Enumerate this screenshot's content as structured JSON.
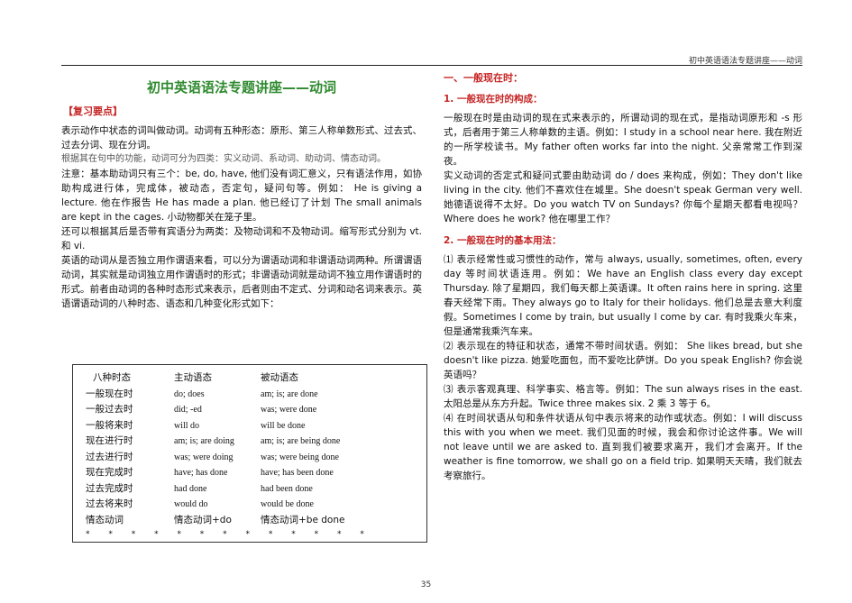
{
  "running_header": "初中英语语法专题讲座——动词",
  "page_number": "35",
  "left": {
    "title": "初中英语语法专题讲座——动词",
    "review_label": "【复习要点】",
    "p1": "表示动作中状态的词叫做动词。动词有五种形态：原形、第三人称单数形式、过去式、过去分词、现在分词。",
    "p2": "根据其在句中的功能，动词可分为四类：实义动词、系动词、助动词、情态动词。",
    "p3": "注意：基本助动词只有三个：be, do, have, 他们没有词汇意义，只有语法作用，如协助构成进行体，完成体，被动态，否定句，疑问句等。例如： He is giving a lecture. 他在作报告 He has made a plan. 他已经订了计划 The small animals are kept in the cages. 小动物都关在笼子里。",
    "p4": "还可以根据其后是否带有宾语分为两类：及物动词和不及物动词。缩写形式分别为 vt. 和 vi.",
    "p5": "英语的动词从是否独立用作谓语来看，可以分为谓语动词和非谓语动词两种。所谓谓语动词，其实就是动词独立用作谓语时的形式；非谓语动词就是动词不独立用作谓语时的形式。前者由动词的各种时态形式来表示，后者则由不定式、分词和动名词来表示。英语谓语动词的八种时态、语态和几种变化形式如下："
  },
  "table": {
    "headers": [
      "八种时态",
      "主动语态",
      "被动语态"
    ],
    "rows": [
      [
        "一般现在时",
        "do; does",
        "am; is; are done"
      ],
      [
        "一般过去时",
        "did; -ed",
        "was; were done"
      ],
      [
        "一般将来时",
        "will do",
        "will be done"
      ],
      [
        "现在进行时",
        "am; is; are doing",
        "am; is; are being done"
      ],
      [
        "过去进行时",
        "was; were doing",
        "was; were being done"
      ],
      [
        "现在完成时",
        "have; has done",
        "have; has been done"
      ],
      [
        "过去完成时",
        "had done",
        "had been done"
      ],
      [
        "过去将来时",
        "would do",
        "would be done"
      ],
      [
        "情态动词",
        "情态动词+do",
        "情态动词+be done"
      ]
    ],
    "stars": "* * * * * * * * * * * * *"
  },
  "right": {
    "section1": "一、一般现在时：",
    "sub1": "1.   一般现在时的构成：",
    "r1": "一般现在时是由动词的现在式来表示的，所谓动词的现在式，是指动词原形和 -s 形式，后者用于第三人称单数的主语。例如：I study in a school near here. 我在附近的一所学校读书。My father often works far into the night. 父亲常常工作到深夜。",
    "r2": "实义动词的否定式和疑问式要由助动词 do / does 来构成，例如：They don't like living in the city. 他们不喜欢住在城里。She doesn't speak German very well. 她德语说得不太好。Do you watch TV on Sundays? 你每个星期天都看电视吗？Where does he work? 他在哪里工作？",
    "sub2": "2.   一般现在时的基本用法：",
    "u1": "⑴ 表示经常性或习惯性的动作，常与 always, usually, sometimes, often, every day 等时间状语连用。例如：We have an English class every day except Thursday. 除了星期四，我们每天都上英语课。It often rains here in spring. 这里春天经常下雨。They always go to Italy for their holidays. 他们总是去意大利度假。Sometimes I come by train, but usually I come by car. 有时我乘火车来，但是通常我乘汽车来。",
    "u2": "⑵ 表示现在的特征和状态，通常不带时间状语。例如： She likes bread, but she doesn't like pizza. 她爱吃面包，而不爱吃比萨饼。Do you speak English? 你会说英语吗？",
    "u3": "⑶ 表示客观真理、科学事实、格言等。例如：The sun always rises in the east. 太阳总是从东方升起。Twice three makes six. 2 乘 3 等于 6。",
    "u4": "⑷ 在时间状语从句和条件状语从句中表示将来的动作或状态。例如：I will discuss this with you when we meet. 我们见面的时候，我会和你讨论这件事。We will not leave until we are asked to. 直到我们被要求离开，我们才会离开。If the weather is fine tomorrow, we shall go on a field trip. 如果明天天晴，我们就去考察旅行。"
  }
}
